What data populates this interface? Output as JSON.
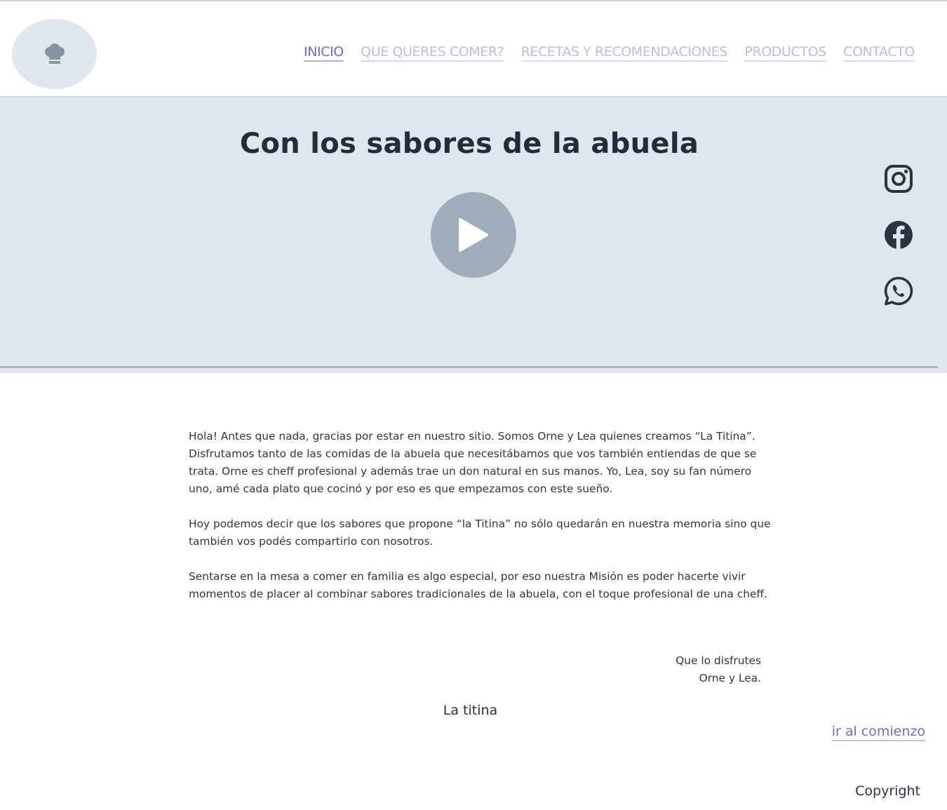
{
  "header": {
    "logo_icon": "chef-hat-icon",
    "nav": [
      {
        "label": "INICIO",
        "active": true
      },
      {
        "label": "QUE QUERES COMER?",
        "active": false
      },
      {
        "label": "RECETAS Y RECOMENDACIONES",
        "active": false
      },
      {
        "label": "PRODUCTOS",
        "active": false
      },
      {
        "label": "CONTACTO",
        "active": false
      }
    ]
  },
  "hero": {
    "title": "Con los sabores de la abuela",
    "play_icon": "play-icon",
    "social": [
      "instagram-icon",
      "facebook-icon",
      "whatsapp-icon"
    ]
  },
  "content": {
    "paragraphs": [
      "Hola! Antes que nada, gracias por estar en nuestro sitio. Somos Orne y Lea quienes creamos “La Titina”. Disfrutamos tanto de las comidas de la abuela que necesitábamos que vos también entiendas de que se trata. Orne es cheff profesional y además trae un don natural en sus manos. Yo, Lea, soy su fan número uno, amé cada plato que cocinó y por eso es que empezamos con este sueño.",
      "Hoy podemos decir que los sabores que propone “la Titina” no sólo quedarán en nuestra memoria sino que también vos podés compartirlo con nosotros.",
      "Sentarse en la mesa a comer en familia es algo especial, por eso nuestra Misión es poder hacerte vivir momentos de placer al combinar sabores tradicionales de la abuela, con el toque profesional de una cheff."
    ],
    "signoff_line1": "Que lo disfrutes",
    "signoff_line2": "Orne y Lea."
  },
  "footer": {
    "brand": "La titina",
    "back_to_top": "ir al comienzo",
    "copyright": "Copyright"
  },
  "colors": {
    "accent": "#7a63e3",
    "nav_inactive": "#c6b6ef",
    "hero_bg": "#dfe6ee",
    "play_button": "#9fadba",
    "text": "#2b3340"
  }
}
